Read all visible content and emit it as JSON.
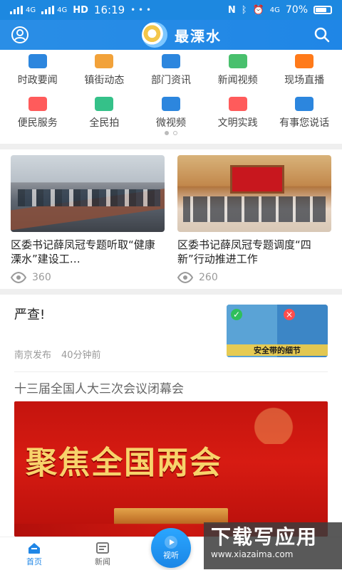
{
  "status": {
    "network_left": "4G",
    "network_mid": "4G",
    "hd": "HD",
    "time": "16:19",
    "more": "• • •",
    "network_right": "4G",
    "battery_text": "70%",
    "battery_level": 0.7
  },
  "header": {
    "app_title": "最溧水",
    "left_icon": "user-icon",
    "right_icon": "search-icon"
  },
  "grid": {
    "row1": [
      {
        "label": "时政要闻",
        "icon": "news-icon",
        "color": "#2c86de"
      },
      {
        "label": "镇街动态",
        "icon": "town-icon",
        "color": "#f2a23a"
      },
      {
        "label": "部门资讯",
        "icon": "org-icon",
        "color": "#2c86de"
      },
      {
        "label": "新闻视频",
        "icon": "video-icon",
        "color": "#49c06d"
      },
      {
        "label": "现场直播",
        "icon": "live-icon",
        "color": "#ff7a1a"
      }
    ],
    "row2": [
      {
        "label": "便民服务",
        "icon": "service-icon",
        "color": "#ff5b5b"
      },
      {
        "label": "全民拍",
        "icon": "camera-icon",
        "color": "#35c189"
      },
      {
        "label": "微视频",
        "icon": "micro-video-icon",
        "color": "#2c86de"
      },
      {
        "label": "文明实践",
        "icon": "flag-icon",
        "color": "#ff5b5b"
      },
      {
        "label": "有事您说话",
        "icon": "megaphone-icon",
        "color": "#2c86de"
      }
    ]
  },
  "carousel": {
    "page_count": 2,
    "active_index": 0
  },
  "cards": [
    {
      "title": "区委书记薛凤冠专题听取“健康溧水”建设工…",
      "views": "360"
    },
    {
      "title": "区委书记薛凤冠专题调度“四新”行动推进工作",
      "views": "260"
    }
  ],
  "news_item_1": {
    "title": "严查!",
    "source": "南京发布",
    "time": "40分钟前",
    "thumb_caption": "安全带的细节"
  },
  "news_item_2": {
    "title": "十三届全国人大三次会议闭幕会",
    "banner_text": "聚焦全国两会"
  },
  "bottom_nav": {
    "home": "首页",
    "news": "新闻",
    "center": "视听"
  },
  "watermark": {
    "line1": "下载写应用",
    "line2": "www.xiazaima.com"
  }
}
